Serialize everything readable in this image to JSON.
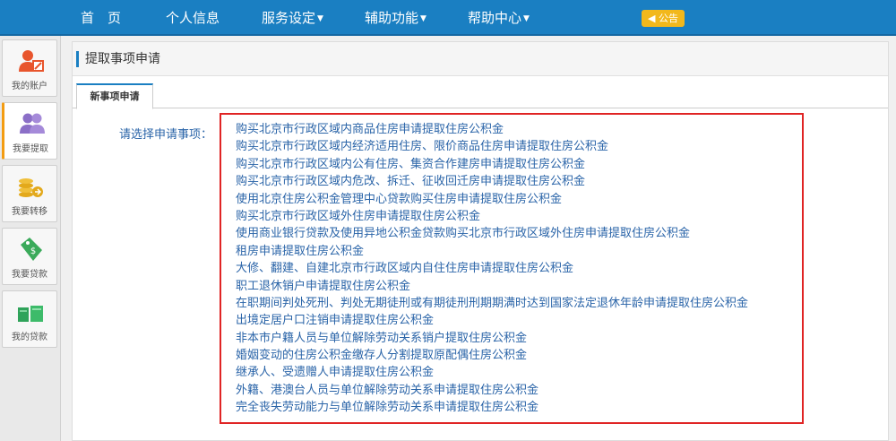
{
  "topnav": {
    "items": [
      {
        "label": "首　页",
        "has_menu": false
      },
      {
        "label": "个人信息",
        "has_menu": false
      },
      {
        "label": "服务设定",
        "has_menu": true
      },
      {
        "label": "辅助功能",
        "has_menu": true
      },
      {
        "label": "帮助中心",
        "has_menu": true
      }
    ],
    "notice_label": "◀ 公告",
    "bg_color": "#1a7fc2"
  },
  "sidebar": {
    "items": [
      {
        "label": "我的账户",
        "icon": "account-icon",
        "active": false
      },
      {
        "label": "我要提取",
        "icon": "withdraw-icon",
        "active": true
      },
      {
        "label": "我要转移",
        "icon": "transfer-icon",
        "active": false
      },
      {
        "label": "我要贷款",
        "icon": "loan-icon",
        "active": false
      },
      {
        "label": "我的贷款",
        "icon": "my-loan-icon",
        "active": false
      }
    ]
  },
  "page": {
    "title": "提取事项申请",
    "tab_label": "新事项申请",
    "prompt": "请选择申请事项：",
    "options": [
      "购买北京市行政区域内商品住房申请提取住房公积金",
      "购买北京市行政区域内经济适用住房、限价商品住房申请提取住房公积金",
      "购买北京市行政区域内公有住房、集资合作建房申请提取住房公积金",
      "购买北京市行政区域内危改、拆迁、征收回迁房申请提取住房公积金",
      "使用北京住房公积金管理中心贷款购买住房申请提取住房公积金",
      "购买北京市行政区域外住房申请提取住房公积金",
      "使用商业银行贷款及使用异地公积金贷款购买北京市行政区域外住房申请提取住房公积金",
      "租房申请提取住房公积金",
      "大修、翻建、自建北京市行政区域内自住住房申请提取住房公积金",
      "职工退休销户申请提取住房公积金",
      "在职期间判处死刑、判处无期徒刑或有期徒刑刑期期满时达到国家法定退休年龄申请提取住房公积金",
      "出境定居户口注销申请提取住房公积金",
      "非本市户籍人员与单位解除劳动关系销户提取住房公积金",
      "婚姻变动的住房公积金缴存人分割提取原配偶住房公积金",
      "继承人、受遗赠人申请提取住房公积金",
      "外籍、港澳台人员与单位解除劳动关系申请提取住房公积金",
      "完全丧失劳动能力与单位解除劳动关系申请提取住房公积金"
    ],
    "highlight_color": "#e02424"
  }
}
